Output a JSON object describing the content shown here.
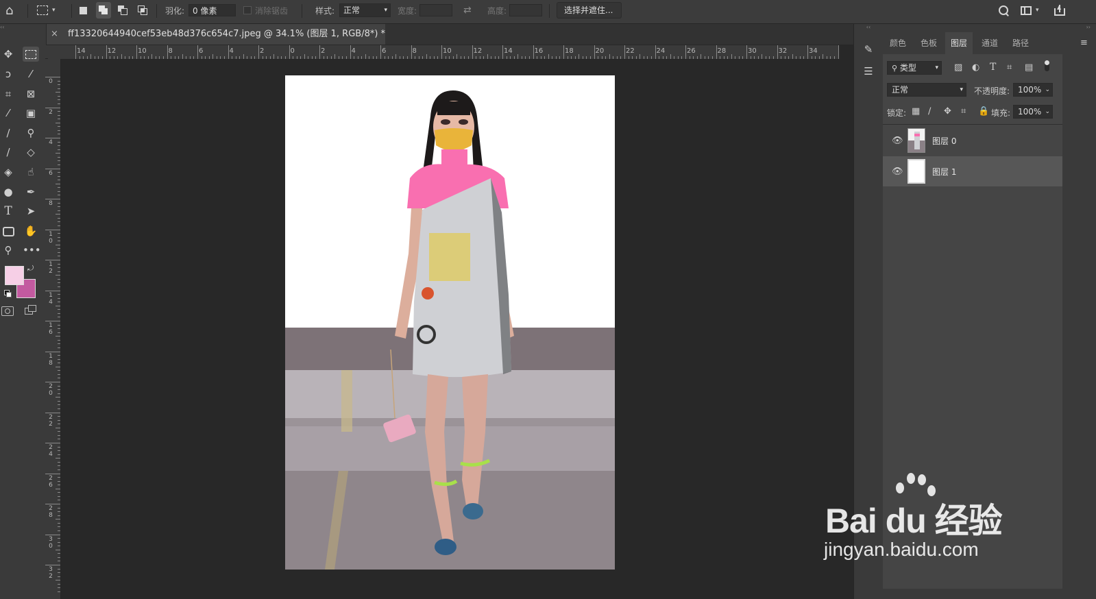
{
  "options_bar": {
    "home_icon": "home-icon",
    "marquee_icon": "rect-marquee-icon",
    "feather_label": "羽化:",
    "feather_value": "0 像素",
    "antialias_label": "消除锯齿",
    "style_label": "样式:",
    "style_value": "正常",
    "width_label": "宽度:",
    "width_value": "",
    "height_label": "高度:",
    "height_value": "",
    "select_mask_button": "选择并遮住...",
    "right_icons": [
      "search-icon",
      "workspace-icon",
      "share-icon"
    ]
  },
  "document_tab": {
    "close": "×",
    "title": "ff13320644940cef53eb48d376c654c7.jpeg @ 34.1% (图层 1, RGB/8*) *"
  },
  "ruler_h_labels": [
    "14",
    "12",
    "10",
    "8",
    "6",
    "4",
    "2",
    "0",
    "2",
    "4",
    "6",
    "8",
    "10",
    "12",
    "14",
    "16",
    "18",
    "20",
    "22",
    "24",
    "26",
    "28",
    "30",
    "32",
    "34",
    "36"
  ],
  "ruler_v_labels": [
    "0",
    "2",
    "4",
    "6",
    "8",
    "1\n0",
    "1\n2",
    "1\n4",
    "1\n6",
    "1\n8",
    "2\n0",
    "2\n2",
    "2\n4",
    "2\n6",
    "2\n8",
    "3\n0",
    "3\n2"
  ],
  "colors": {
    "foreground": "#f6cfe6",
    "background": "#c35aa0",
    "accent_pink": "#f96fb0"
  },
  "panels": {
    "tabs": [
      "颜色",
      "色板",
      "图层",
      "通道",
      "路径"
    ],
    "active_tab": "图层",
    "filter_kind": "类型",
    "blend_mode": "正常",
    "opacity_label": "不透明度:",
    "opacity_value": "100%",
    "lock_label": "锁定:",
    "fill_label": "填充:",
    "fill_value": "100%",
    "layers": [
      {
        "name": "图层 0",
        "visible": true,
        "selected": false
      },
      {
        "name": "图层 1",
        "visible": true,
        "selected": true
      }
    ]
  },
  "watermark": {
    "brand": "Bai du 经验",
    "url": "jingyan.baidu.com"
  }
}
